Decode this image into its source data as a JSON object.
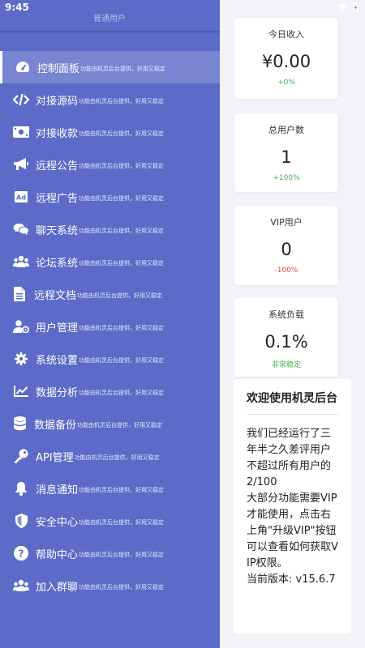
{
  "status_bar": {
    "time": "9:45"
  },
  "drawer": {
    "top_label": "普通用户",
    "description": "功能由机灵后台提供，好用又稳定",
    "items": [
      {
        "label": "控制面板",
        "icon": "dashboard-icon",
        "active": true
      },
      {
        "label": "对接源码",
        "icon": "code-icon"
      },
      {
        "label": "对接收款",
        "icon": "money-icon"
      },
      {
        "label": "远程公告",
        "icon": "megaphone-icon"
      },
      {
        "label": "远程广告",
        "icon": "ad-icon"
      },
      {
        "label": "聊天系统",
        "icon": "chat-icon"
      },
      {
        "label": "论坛系统",
        "icon": "users-icon"
      },
      {
        "label": "远程文档",
        "icon": "document-icon"
      },
      {
        "label": "用户管理",
        "icon": "user-manage-icon"
      },
      {
        "label": "系统设置",
        "icon": "gear-icon"
      },
      {
        "label": "数据分析",
        "icon": "chart-icon"
      },
      {
        "label": "数据备份",
        "icon": "database-icon"
      },
      {
        "label": "API管理",
        "icon": "key-icon"
      },
      {
        "label": "消息通知",
        "icon": "bell-icon"
      },
      {
        "label": "安全中心",
        "icon": "shield-icon"
      },
      {
        "label": "帮助中心",
        "icon": "help-icon"
      },
      {
        "label": "加入群聊",
        "icon": "group-icon"
      }
    ]
  },
  "stats": [
    {
      "label": "今日收入",
      "value": "¥0.00",
      "delta": "+0%",
      "trend": "up"
    },
    {
      "label": "总用户数",
      "value": "1",
      "delta": "+100%",
      "trend": "up"
    },
    {
      "label": "VIP用户",
      "value": "0",
      "delta": "-100%",
      "trend": "down"
    },
    {
      "label": "系统负载",
      "value": "0.1%",
      "delta": "非常稳定",
      "trend": "up"
    }
  ],
  "welcome": {
    "title": "欢迎使用机灵后台",
    "body": "我们已经运行了三年半之久差评用户不超过所有用户的2/100\n大部分功能需要VIP才能使用，点击右上角\"升级VIP\"按钮可以查看如何获取VIP权限。\n当前版本: v15.6.7"
  },
  "colors": {
    "drawer": "#5b6bc7",
    "up": "#3fae4c",
    "down": "#e0493f"
  }
}
